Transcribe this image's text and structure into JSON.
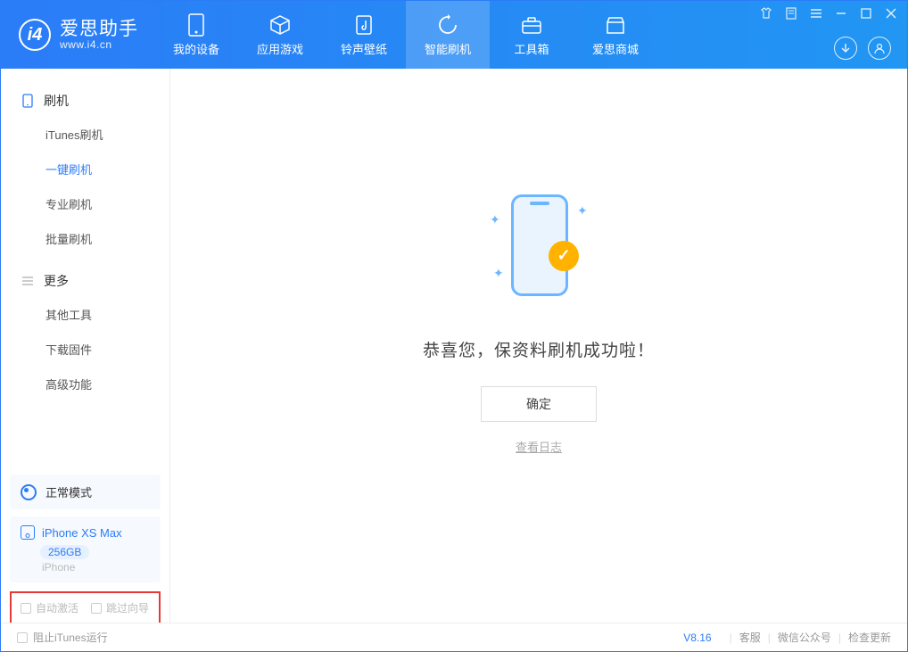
{
  "app": {
    "title": "爱思助手",
    "subtitle": "www.i4.cn"
  },
  "tabs": [
    {
      "label": "我的设备"
    },
    {
      "label": "应用游戏"
    },
    {
      "label": "铃声壁纸"
    },
    {
      "label": "智能刷机"
    },
    {
      "label": "工具箱"
    },
    {
      "label": "爱思商城"
    }
  ],
  "sidebar": {
    "flash_section": "刷机",
    "items_flash": [
      {
        "label": "iTunes刷机"
      },
      {
        "label": "一键刷机"
      },
      {
        "label": "专业刷机"
      },
      {
        "label": "批量刷机"
      }
    ],
    "more_section": "更多",
    "items_more": [
      {
        "label": "其他工具"
      },
      {
        "label": "下载固件"
      },
      {
        "label": "高级功能"
      }
    ]
  },
  "mode": {
    "label": "正常模式"
  },
  "device": {
    "name": "iPhone XS Max",
    "capacity": "256GB",
    "type": "iPhone"
  },
  "options": {
    "auto_activate": "自动激活",
    "skip_guide": "跳过向导"
  },
  "main": {
    "success_text": "恭喜您，保资料刷机成功啦！",
    "ok_btn": "确定",
    "log_link": "查看日志"
  },
  "footer": {
    "block_itunes": "阻止iTunes运行",
    "version": "V8.16",
    "support": "客服",
    "wechat": "微信公众号",
    "check_update": "检查更新"
  }
}
